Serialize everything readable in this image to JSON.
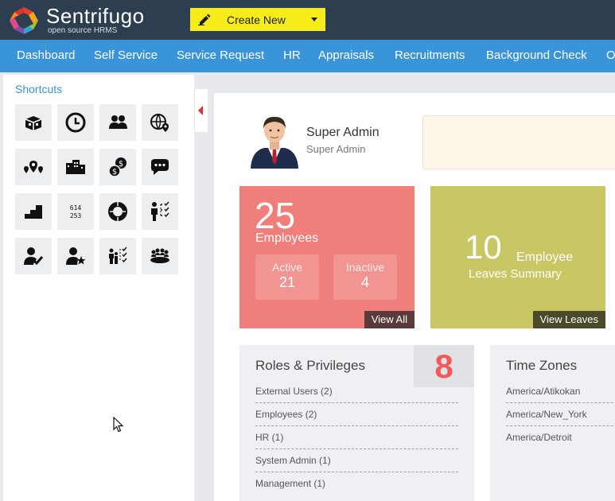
{
  "header": {
    "brand": "Sentrifugo",
    "brand_sub": "open source HRMS",
    "create_label": "Create New"
  },
  "nav": {
    "items": [
      "Dashboard",
      "Self Service",
      "Service Request",
      "HR",
      "Appraisals",
      "Recruitments",
      "Background Check",
      "Or"
    ]
  },
  "sidebar": {
    "title": "Shortcuts",
    "shortcuts": [
      "money-icon",
      "clock-icon",
      "users-icon",
      "globe-pin-icon",
      "map-pins-icon",
      "buildings-icon",
      "coins-icon",
      "chat-icon",
      "steps-icon",
      "numbers-icon",
      "ring-chart-icon",
      "org-checklist-icon",
      "user-check-icon",
      "user-star-icon",
      "team-checklist-icon",
      "meeting-icon"
    ]
  },
  "user": {
    "name": "Super Admin",
    "role": "Super Admin"
  },
  "employees": {
    "count": "25",
    "label": "Employees",
    "active_label": "Active",
    "active_value": "21",
    "inactive_label": "Inactive",
    "inactive_value": "4",
    "view_all": "View All"
  },
  "leaves": {
    "count": "10",
    "label_line1": "Employee",
    "label_line2": "Leaves Summary",
    "view_label": "View Leaves"
  },
  "roles": {
    "title": "Roles & Privileges",
    "count": "8",
    "items": [
      "External Users (2)",
      "Employees (2)",
      "HR (1)",
      "System Admin (1)",
      "Management (1)"
    ]
  },
  "timezones": {
    "title": "Time Zones",
    "items": [
      "America/Atikokan",
      "America/New_York",
      "America/Detroit"
    ]
  },
  "colors": {
    "header": "#2c3e50",
    "nav": "#3a95d8",
    "create_button": "#f6ec1a",
    "employee_card": "#f07e7a",
    "leave_card": "#c9c664",
    "accent_red": "#f05a5a"
  }
}
